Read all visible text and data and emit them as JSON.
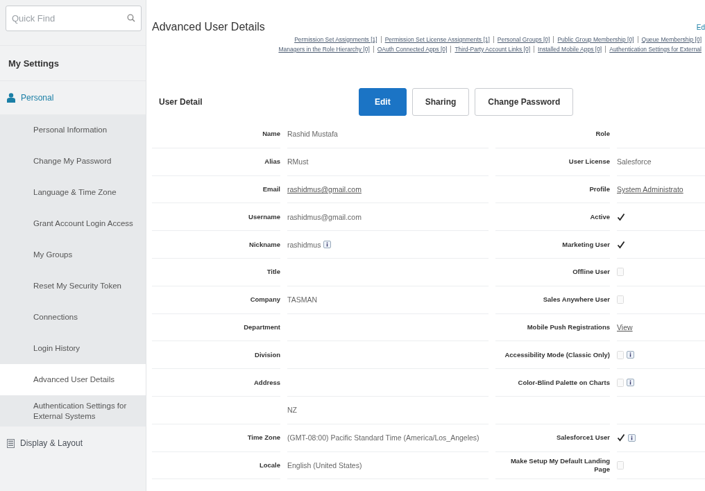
{
  "sidebar": {
    "search": {
      "placeholder": "Quick Find"
    },
    "heading": "My Settings",
    "sections": [
      {
        "label": "Personal",
        "expanded": true,
        "children": [
          {
            "label": "Personal Information",
            "selected": false
          },
          {
            "label": "Change My Password",
            "selected": false
          },
          {
            "label": "Language & Time Zone",
            "selected": false
          },
          {
            "label": "Grant Account Login Access",
            "selected": false
          },
          {
            "label": "My Groups",
            "selected": false
          },
          {
            "label": "Reset My Security Token",
            "selected": false
          },
          {
            "label": "Connections",
            "selected": false
          },
          {
            "label": "Login History",
            "selected": false
          },
          {
            "label": "Advanced User Details",
            "selected": true
          },
          {
            "label": "Authentication Settings for External Systems",
            "selected": false
          }
        ]
      },
      {
        "label": "Display & Layout",
        "expanded": false
      }
    ]
  },
  "page": {
    "title": "Advanced User Details",
    "corner_link": "Ed",
    "related_links": [
      [
        "Permission Set Assignments [1]",
        "Permission Set License Assignments [1]",
        "Personal Groups [0]",
        "Public Group Membership [0]",
        "Queue Membership [0]"
      ],
      [
        "Managers in the Role Hierarchy [0]",
        "OAuth Connected Apps [0]",
        "Third-Party Account Links [0]",
        "Installed Mobile Apps [0]",
        "Authentication Settings for External"
      ]
    ]
  },
  "detail": {
    "title": "User Detail",
    "buttons": [
      {
        "label": "Edit",
        "primary": true
      },
      {
        "label": "Sharing",
        "primary": false
      },
      {
        "label": "Change Password",
        "primary": false
      }
    ],
    "rows": [
      {
        "left": {
          "label": "Name",
          "kind": "text",
          "value": "Rashid Mustafa"
        },
        "right": {
          "label": "Role",
          "kind": "text"
        }
      },
      {
        "left": {
          "label": "Alias",
          "kind": "text",
          "value": "RMust"
        },
        "right": {
          "label": "User License",
          "kind": "text",
          "value": "Salesforce"
        }
      },
      {
        "left": {
          "label": "Email",
          "kind": "link",
          "value": "rashidmus@gmail.com"
        },
        "right": {
          "label": "Profile",
          "kind": "link",
          "value": "System Administrato"
        }
      },
      {
        "left": {
          "label": "Username",
          "kind": "text",
          "value": "rashidmus@gmail.com"
        },
        "right": {
          "label": "Active",
          "kind": "checkbox",
          "checked": true
        }
      },
      {
        "left": {
          "label": "Nickname",
          "kind": "text",
          "value": "rashidmus",
          "help": true
        },
        "right": {
          "label": "Marketing User",
          "kind": "checkbox",
          "checked": true
        }
      },
      {
        "left": {
          "label": "Title",
          "kind": "text"
        },
        "right": {
          "label": "Offline User",
          "kind": "checkbox",
          "checked": false
        }
      },
      {
        "left": {
          "label": "Company",
          "kind": "text",
          "value": "TASMAN"
        },
        "right": {
          "label": "Sales Anywhere User",
          "kind": "checkbox",
          "checked": false
        }
      },
      {
        "left": {
          "label": "Department",
          "kind": "text"
        },
        "right": {
          "label": "Mobile Push Registrations",
          "kind": "link",
          "value": "View"
        }
      },
      {
        "left": {
          "label": "Division",
          "kind": "text"
        },
        "right": {
          "label": "Accessibility Mode (Classic Only)",
          "kind": "checkbox",
          "checked": false,
          "help": true
        }
      },
      {
        "left": {
          "label": "Address",
          "kind": "text"
        },
        "right": {
          "label": "Color-Blind Palette on Charts",
          "kind": "checkbox",
          "checked": false,
          "help": true
        }
      },
      {
        "left": {
          "kind": "text",
          "value": "NZ"
        }
      },
      {
        "left": {
          "label": "Time Zone",
          "kind": "text",
          "value": "(GMT-08:00) Pacific Standard Time (America/Los_Angeles)"
        },
        "right": {
          "label": "Salesforce1 User",
          "kind": "checkbox",
          "checked": true,
          "help": true
        }
      },
      {
        "left": {
          "label": "Locale",
          "kind": "text",
          "value": "English (United States)"
        },
        "right": {
          "label": "Make Setup My Default Landing Page",
          "kind": "checkbox",
          "checked": false
        }
      }
    ]
  }
}
